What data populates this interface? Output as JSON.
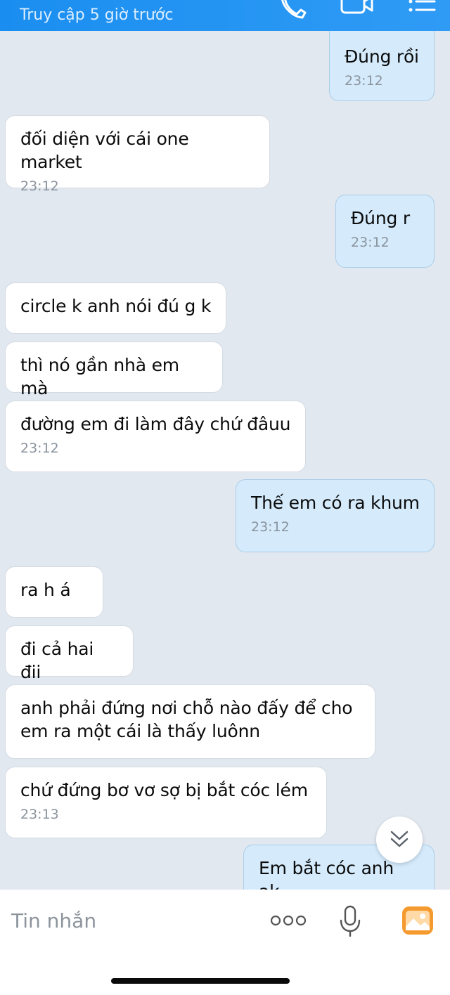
{
  "header": {
    "status": "Truy cập 5 giờ trước",
    "icons": [
      "phone-icon",
      "video-call-icon",
      "menu-icon"
    ]
  },
  "messages": [
    {
      "side": "out",
      "text": "Đúng rồi",
      "time": "23:12"
    },
    {
      "side": "in",
      "text": "đối diện với cái one market",
      "time": "23:12"
    },
    {
      "side": "out",
      "text": "Đúng r",
      "time": "23:12"
    },
    {
      "side": "in",
      "text": "circle k anh nói đú g k",
      "time": ""
    },
    {
      "side": "in",
      "text": "thì nó gần nhà em mà",
      "time": ""
    },
    {
      "side": "in",
      "text": "đường em đi làm đây chứ đâuu",
      "time": "23:12"
    },
    {
      "side": "out",
      "text": "Thế em có ra khum",
      "time": "23:12"
    },
    {
      "side": "in",
      "text": "ra h á",
      "time": ""
    },
    {
      "side": "in",
      "text": "đi cả hai đii",
      "time": ""
    },
    {
      "side": "in",
      "text": "anh phải đứng nơi chỗ nào đấy để cho\nem ra một cái là thấy luônn",
      "time": ""
    },
    {
      "side": "in",
      "text": "chứ đứng bơ vơ sợ bị bắt cóc lém",
      "time": "23:13"
    },
    {
      "side": "out",
      "text": "Em bắt cóc anh ak",
      "time": ""
    }
  ],
  "composer": {
    "placeholder": "Tin nhắn",
    "icons": [
      "more-options-icon",
      "microphone-icon",
      "image-icon"
    ]
  },
  "scroll_button": {
    "icon": "double-chevron-down-icon"
  },
  "colors": {
    "header": "#1a8ef0",
    "background": "#e2e8f0",
    "incoming_bubble": "#ffffff",
    "outgoing_bubble": "#d5ebfc",
    "image_icon": "#f59a2e"
  }
}
